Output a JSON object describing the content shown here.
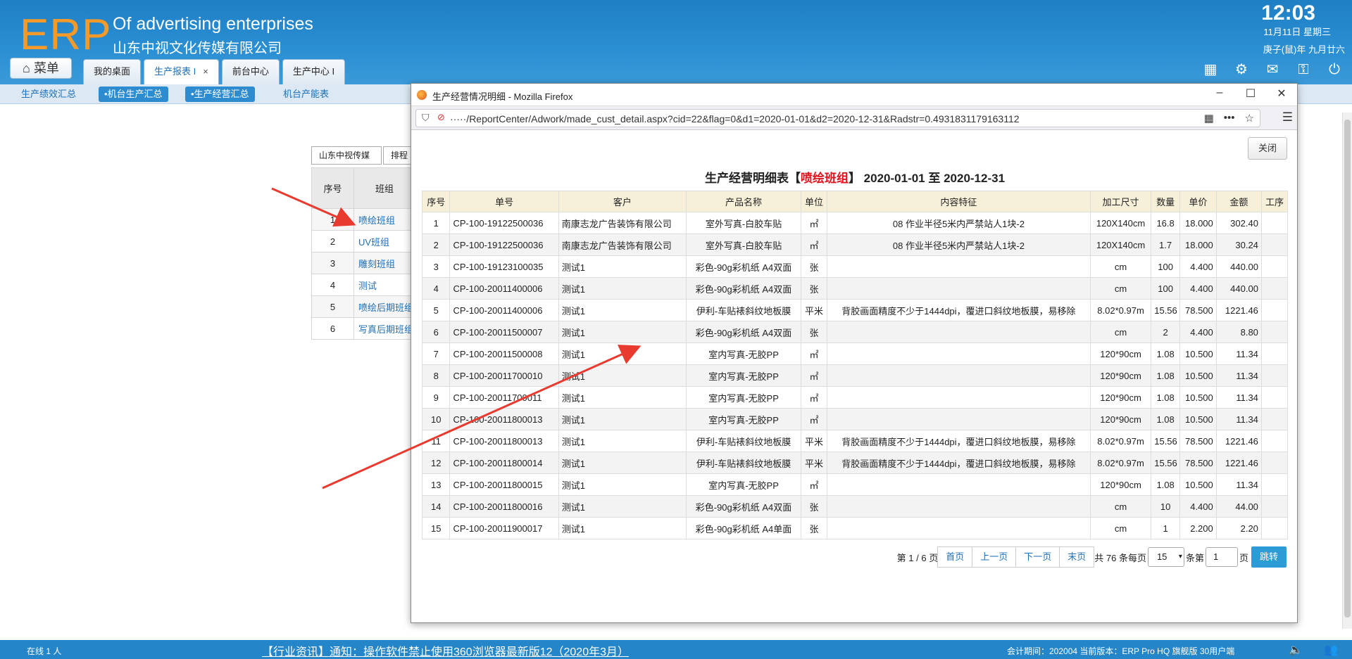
{
  "header": {
    "logo": "ERP",
    "slogan": "Of advertising enterprises",
    "company": "山东中视文化传媒有限公司",
    "time": "12:03",
    "date": "11月11日 星期三",
    "lunar": "庚子(鼠)年 九月廿六",
    "menu_label": "菜单",
    "tabs": [
      {
        "label": "我的桌面"
      },
      {
        "label": "生产报表 I",
        "close": "×"
      },
      {
        "label": "前台中心"
      },
      {
        "label": "生产中心 I"
      }
    ],
    "icons": [
      "grid-icon",
      "gear-icon",
      "gift-icon",
      "key-icon",
      "power-icon"
    ]
  },
  "subnav": {
    "items": [
      "生产绩效汇总",
      "•机台生产汇总",
      "•生产经营汇总",
      "机台产能表"
    ]
  },
  "background": {
    "select1": "山东中视传媒",
    "select2": "排程",
    "headers": [
      "序号",
      "班组"
    ],
    "rows": [
      {
        "idx": "1",
        "name": "喷绘班组"
      },
      {
        "idx": "2",
        "name": "UV班组"
      },
      {
        "idx": "3",
        "name": "雕刻班组"
      },
      {
        "idx": "4",
        "name": "测试"
      },
      {
        "idx": "5",
        "name": "喷绘后期班组"
      },
      {
        "idx": "6",
        "name": "写真后期班组"
      }
    ]
  },
  "popup": {
    "window_title": "生产经营情况明细 - Mozilla Firefox",
    "url": "·····/ReportCenter/Adwork/made_cust_detail.aspx?cid=22&flag=0&d1=2020-01-01&d2=2020-12-31&Radstr=0.4931831179163112",
    "close_label": "关闭",
    "report_title_prefix": "生产经营明细表【",
    "report_title_group": "喷绘班组",
    "report_title_suffix": "】 2020-01-01 至 2020-12-31",
    "columns": [
      "序号",
      "单号",
      "客户",
      "产品名称",
      "单位",
      "内容特征",
      "加工尺寸",
      "数量",
      "单价",
      "金额",
      "工序"
    ],
    "rows": [
      {
        "no": "1",
        "order": "CP-100-19122500036",
        "customer": "南康志龙广告装饰有限公司",
        "product": "室外写真-白胶车贴",
        "unit": "㎡",
        "feature": "08 作业半径5米内严禁站人1块-2",
        "size": "120X140cm",
        "qty": "16.8",
        "price": "18.000",
        "amount": "302.40",
        "proc": ""
      },
      {
        "no": "2",
        "order": "CP-100-19122500036",
        "customer": "南康志龙广告装饰有限公司",
        "product": "室外写真-白胶车贴",
        "unit": "㎡",
        "feature": "08 作业半径5米内严禁站人1块-2",
        "size": "120X140cm",
        "qty": "1.7",
        "price": "18.000",
        "amount": "30.24",
        "proc": ""
      },
      {
        "no": "3",
        "order": "CP-100-19123100035",
        "customer": "测试1",
        "product": "彩色-90g彩机纸 A4双面",
        "unit": "张",
        "feature": "",
        "size": "cm",
        "qty": "100",
        "price": "4.400",
        "amount": "440.00",
        "proc": ""
      },
      {
        "no": "4",
        "order": "CP-100-20011400006",
        "customer": "测试1",
        "product": "彩色-90g彩机纸 A4双面",
        "unit": "张",
        "feature": "",
        "size": "cm",
        "qty": "100",
        "price": "4.400",
        "amount": "440.00",
        "proc": ""
      },
      {
        "no": "5",
        "order": "CP-100-20011400006",
        "customer": "测试1",
        "product": "伊利-车贴裱斜纹地板膜",
        "unit": "平米",
        "feature": "背胶画面精度不少于1444dpi，覆进口斜纹地板膜，易移除",
        "size": "8.02*0.97m",
        "qty": "15.56",
        "price": "78.500",
        "amount": "1221.46",
        "proc": ""
      },
      {
        "no": "6",
        "order": "CP-100-20011500007",
        "customer": "测试1",
        "product": "彩色-90g彩机纸 A4双面",
        "unit": "张",
        "feature": "",
        "size": "cm",
        "qty": "2",
        "price": "4.400",
        "amount": "8.80",
        "proc": ""
      },
      {
        "no": "7",
        "order": "CP-100-20011500008",
        "customer": "测试1",
        "product": "室内写真-无胶PP",
        "unit": "㎡",
        "feature": "",
        "size": "120*90cm",
        "qty": "1.08",
        "price": "10.500",
        "amount": "11.34",
        "proc": ""
      },
      {
        "no": "8",
        "order": "CP-100-20011700010",
        "customer": "测试1",
        "product": "室内写真-无胶PP",
        "unit": "㎡",
        "feature": "",
        "size": "120*90cm",
        "qty": "1.08",
        "price": "10.500",
        "amount": "11.34",
        "proc": ""
      },
      {
        "no": "9",
        "order": "CP-100-20011700011",
        "customer": "测试1",
        "product": "室内写真-无胶PP",
        "unit": "㎡",
        "feature": "",
        "size": "120*90cm",
        "qty": "1.08",
        "price": "10.500",
        "amount": "11.34",
        "proc": ""
      },
      {
        "no": "10",
        "order": "CP-100-20011800013",
        "customer": "测试1",
        "product": "室内写真-无胶PP",
        "unit": "㎡",
        "feature": "",
        "size": "120*90cm",
        "qty": "1.08",
        "price": "10.500",
        "amount": "11.34",
        "proc": ""
      },
      {
        "no": "11",
        "order": "CP-100-20011800013",
        "customer": "测试1",
        "product": "伊利-车贴裱斜纹地板膜",
        "unit": "平米",
        "feature": "背胶画面精度不少于1444dpi，覆进口斜纹地板膜，易移除",
        "size": "8.02*0.97m",
        "qty": "15.56",
        "price": "78.500",
        "amount": "1221.46",
        "proc": ""
      },
      {
        "no": "12",
        "order": "CP-100-20011800014",
        "customer": "测试1",
        "product": "伊利-车贴裱斜纹地板膜",
        "unit": "平米",
        "feature": "背胶画面精度不少于1444dpi，覆进口斜纹地板膜，易移除",
        "size": "8.02*0.97m",
        "qty": "15.56",
        "price": "78.500",
        "amount": "1221.46",
        "proc": ""
      },
      {
        "no": "13",
        "order": "CP-100-20011800015",
        "customer": "测试1",
        "product": "室内写真-无胶PP",
        "unit": "㎡",
        "feature": "",
        "size": "120*90cm",
        "qty": "1.08",
        "price": "10.500",
        "amount": "11.34",
        "proc": ""
      },
      {
        "no": "14",
        "order": "CP-100-20011800016",
        "customer": "测试1",
        "product": "彩色-90g彩机纸 A4双面",
        "unit": "张",
        "feature": "",
        "size": "cm",
        "qty": "10",
        "price": "4.400",
        "amount": "44.00",
        "proc": ""
      },
      {
        "no": "15",
        "order": "CP-100-20011900017",
        "customer": "测试1",
        "product": "彩色-90g彩机纸 A4单面",
        "unit": "张",
        "feature": "",
        "size": "cm",
        "qty": "1",
        "price": "2.200",
        "amount": "2.20",
        "proc": ""
      }
    ],
    "pager": {
      "page_info": "第 1 / 6 页",
      "first": "首页",
      "prev": "上一页",
      "next": "下一页",
      "last": "末页",
      "total": "共 76 条每页",
      "per_page": "15",
      "goto_prefix": "条第",
      "goto_value": "1",
      "goto_suffix": "页",
      "go": "跳转"
    }
  },
  "footer": {
    "online": "在线   1   人",
    "notice": "【行业资讯】通知：操作软件禁止使用360浏览器最新版12（2020年3月）",
    "info": "会计期间：202004  当前版本：ERP Pro HQ 旗舰版 30用户端"
  },
  "colors": {
    "header_blue": "#2b8fd3",
    "logo_orange": "#f39a2b",
    "highlight_red": "#e0141c",
    "annotation_red": "#e83a2e"
  }
}
